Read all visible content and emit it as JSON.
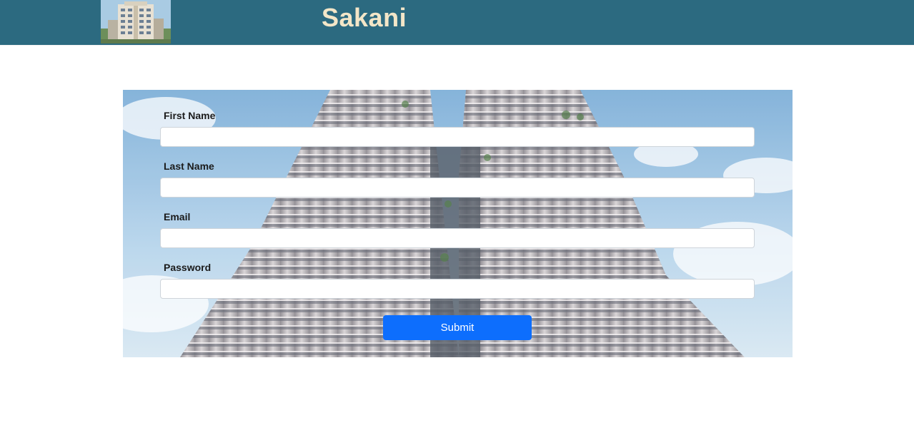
{
  "header": {
    "brand": "Sakani",
    "logo_icon": "apartment-building-photo",
    "background_color": "#2c6a80",
    "brand_color": "#f3e6c8"
  },
  "form": {
    "background_image": "skyscraper-photo",
    "fields": [
      {
        "label": "First Name",
        "value": ""
      },
      {
        "label": "Last Name",
        "value": ""
      },
      {
        "label": "Email",
        "value": ""
      },
      {
        "label": "Password",
        "value": ""
      }
    ],
    "submit_label": "Submit",
    "submit_color": "#0d6efd"
  }
}
